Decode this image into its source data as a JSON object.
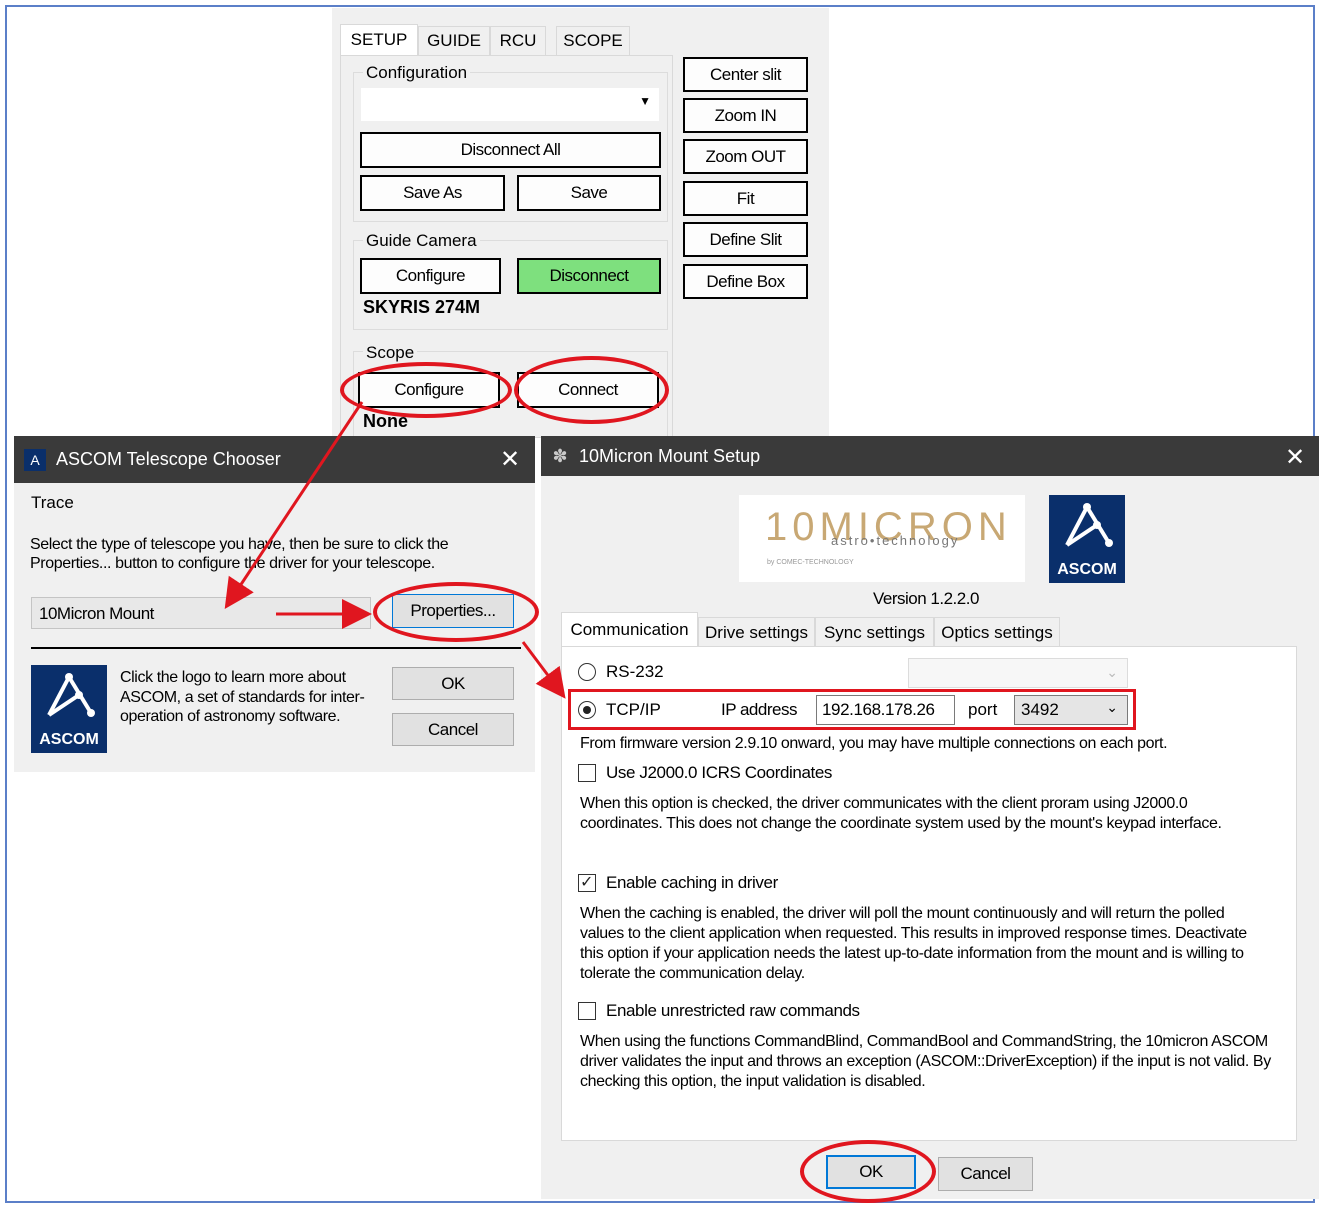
{
  "setup_panel": {
    "tabs": [
      "SETUP",
      "GUIDE",
      "RCU",
      "SCOPE"
    ],
    "configuration": {
      "label": "Configuration",
      "dropdown_value": "",
      "disconnect_all": "Disconnect All",
      "save_as": "Save As",
      "save": "Save"
    },
    "guide_camera": {
      "label": "Guide Camera",
      "configure": "Configure",
      "disconnect": "Disconnect",
      "camera_name": "SKYRIS 274M"
    },
    "scope": {
      "label": "Scope",
      "configure": "Configure",
      "connect": "Connect",
      "status": "None"
    },
    "side_buttons": [
      "Center slit",
      "Zoom IN",
      "Zoom OUT",
      "Fit",
      "Define Slit",
      "Define Box"
    ]
  },
  "chooser": {
    "title": "ASCOM Telescope Chooser",
    "menu": "Trace",
    "instructions": "Select the type of telescope you have, then be sure to click the Properties... button to configure the driver for your telescope.",
    "selected": "10Micron Mount",
    "properties": "Properties...",
    "about": "Click the logo to learn more about ASCOM, a set of standards for inter-operation of astronomy software.",
    "ok": "OK",
    "cancel": "Cancel",
    "logo_text": "ASCOM"
  },
  "mount_setup": {
    "title": "10Micron Mount Setup",
    "logo_text": "10MICRON",
    "logo_sub": "astro•technology",
    "logo_small": "by COMEC-TECHNOLOGY",
    "ascom_logo_text": "ASCOM",
    "version": "Version 1.2.2.0",
    "tabs": [
      "Communication",
      "Drive settings",
      "Sync settings",
      "Optics settings"
    ],
    "rs232_label": "RS-232",
    "tcpip_label": "TCP/IP",
    "ip_label": "IP address",
    "ip_value": "192.168.178.26",
    "port_label": "port",
    "port_value": "3492",
    "firmware_note": "From firmware version 2.9.10 onward, you may have multiple connections on each port.",
    "options": [
      {
        "label": "Use J2000.0 ICRS Coordinates",
        "checked": false,
        "desc": "When this option is checked, the driver communicates with the client proram using J2000.0 coordinates. This does not change the coordinate system used by the mount's keypad interface."
      },
      {
        "label": "Enable caching in driver",
        "checked": true,
        "desc": "When the caching is enabled, the driver will poll the mount continuously and will return the polled values to the client application when requested. This results in improved response times. Deactivate this option if your application needs the latest up-to-date information from the mount and is willing to tolerate the communication delay."
      },
      {
        "label": "Enable unrestricted raw commands",
        "checked": false,
        "desc": "When using the functions CommandBlind, CommandBool and CommandString, the 10micron ASCOM driver validates the input and throws an exception (ASCOM::DriverException) if the input is not valid. By checking this option, the input validation is disabled."
      }
    ],
    "ok": "OK",
    "cancel": "Cancel"
  },
  "colors": {
    "annotation": "#e0161f",
    "disconnect_green": "#7ee07e",
    "ascom_blue": "#0a2f6b",
    "titlebar": "#3a3a3a",
    "frame": "#5b7fc8"
  }
}
